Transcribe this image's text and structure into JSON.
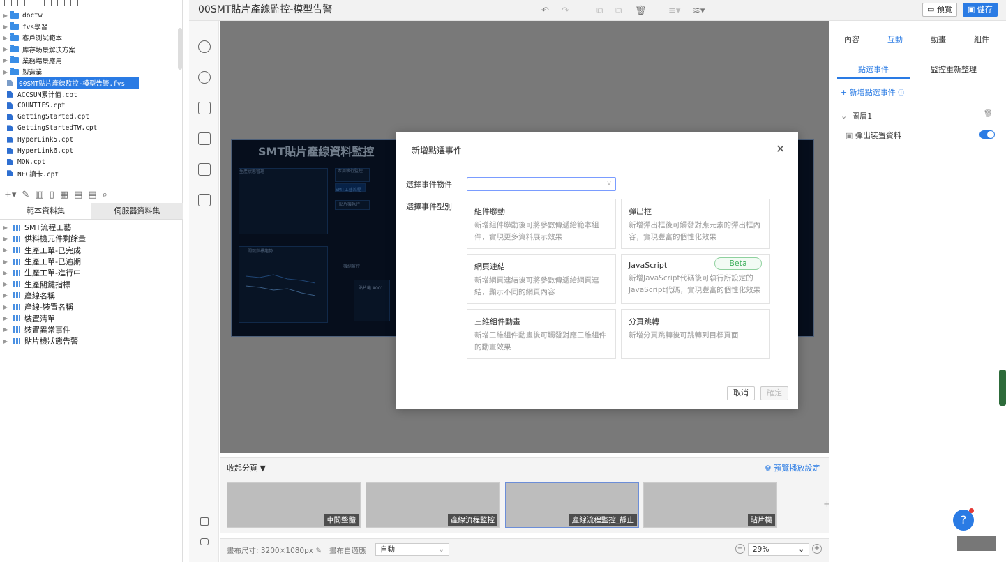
{
  "header": {
    "title": "00SMT貼片產線監控-模型告警",
    "preview_label": "預覽",
    "save_label": "儲存"
  },
  "file_tree": [
    {
      "label": "doctw",
      "type": "folder"
    },
    {
      "label": "fvs學習",
      "type": "folder"
    },
    {
      "label": "客戶測試範本",
      "type": "folder"
    },
    {
      "label": "库存场景解决方案",
      "type": "folder"
    },
    {
      "label": "業務場景應用",
      "type": "folder"
    },
    {
      "label": "製造業",
      "type": "folder"
    },
    {
      "label": "00SMT貼片產線監控-模型告警.fvs",
      "type": "fvs",
      "selected": true
    },
    {
      "label": "ACCSUM累计值.cpt",
      "type": "file"
    },
    {
      "label": "COUNTIFS.cpt",
      "type": "file"
    },
    {
      "label": "GettingStarted.cpt",
      "type": "file"
    },
    {
      "label": "GettingStartedTW.cpt",
      "type": "file"
    },
    {
      "label": "HyperLink5.cpt",
      "type": "file"
    },
    {
      "label": "HyperLink6.cpt",
      "type": "file"
    },
    {
      "label": "MON.cpt",
      "type": "file"
    },
    {
      "label": "NFC讀卡.cpt",
      "type": "file"
    }
  ],
  "dataset_tabs": {
    "template": "範本資料集",
    "server": "伺服器資料集"
  },
  "datasets": [
    "SMT流程工藝",
    "供料機元件剩餘量",
    "生產工單-已完成",
    "生產工單-已逾期",
    "生產工單-進行中",
    "生產關鍵指標",
    "產線名稱",
    "產線-裝置名稱",
    "裝置清單",
    "裝置異常事件",
    "貼片機狀態告警"
  ],
  "canvas": {
    "mock_title": "SMT貼片產線資料監控",
    "mock_sub1": "生產狀態管理",
    "mock_sub2": "本周執行監控",
    "mock_chip": "SMT工藝流程",
    "mock_btn2": "貼片機執行",
    "mock_btn3": "機組監控",
    "mock_chart": "關鍵指標趨勢",
    "mock_machine": "貼片機 A001"
  },
  "pages": {
    "collapse_label": "收起分頁 ▼",
    "play_setting": "⚙ 預覽播放設定",
    "thumbs": [
      "車間整體",
      "產線流程監控",
      "產線流程監控_靜止",
      "貼片機"
    ]
  },
  "statusbar": {
    "canvas_size": "畫布尺寸: 3200×1080px",
    "adapt_label": "畫布自適應",
    "adapt_value": "自動",
    "zoom": "29%"
  },
  "right_panel": {
    "tabs": [
      "內容",
      "互動",
      "動畫",
      "組件"
    ],
    "active_tab": 1,
    "subtabs": [
      "點選事件",
      "監控重新整理"
    ],
    "add_event": "+ 新增點選事件",
    "layer": "圖層1",
    "layer_item": "彈出裝置資料"
  },
  "modal": {
    "title": "新增點選事件",
    "object_label": "選擇事件物件",
    "type_label": "選擇事件型別",
    "cards": [
      {
        "title": "組件聯動",
        "desc": "新增組件聯動後可將參數傳遞給範本組件，實現更多資料展示效果"
      },
      {
        "title": "彈出框",
        "desc": "新增彈出框後可觸發對應元素的彈出框內容，實現豐富的個性化效果"
      },
      {
        "title": "網頁連結",
        "desc": "新增網頁連結後可將參數傳遞給網頁連結，顯示不同的網頁內容"
      },
      {
        "title": "JavaScript",
        "desc": "新增JavaScript代碼後可執行所設定的JavaScript代碼，實現豐富的個性化效果",
        "badge": "Beta"
      },
      {
        "title": "三維組件動畫",
        "desc": "新增三維組件動畫後可觸發對應三維組件的動畫效果"
      },
      {
        "title": "分頁跳轉",
        "desc": "新增分頁跳轉後可跳轉到目標頁面"
      }
    ],
    "cancel_label": "取消",
    "confirm_label": "確定"
  },
  "help_label": "?"
}
